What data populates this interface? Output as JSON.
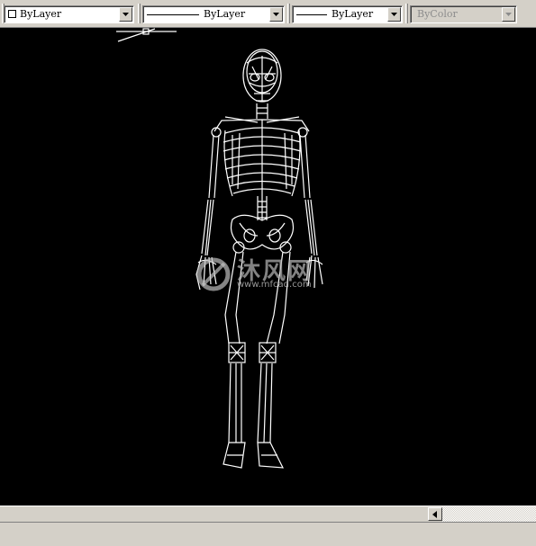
{
  "toolbar": {
    "color_control": {
      "value": "ByLayer",
      "swatch_color": "#ffffff",
      "icon": "color-swatch"
    },
    "linetype_control": {
      "value": "ByLayer",
      "icon": "line-sample"
    },
    "lineweight_control": {
      "value": "ByLayer",
      "icon": "line-sample"
    },
    "plotstyle_control": {
      "value": "ByColor",
      "enabled": false
    },
    "dropdown_icon": "chevron-down-icon"
  },
  "drawing": {
    "background": "#000000",
    "stroke_color": "#ffffff",
    "subject": "human skeleton wireframe",
    "watermark": {
      "text": "沐风网",
      "url": "www.mfcad.com"
    }
  },
  "scrollbar": {
    "left_arrow_icon": "arrow-left-icon"
  }
}
